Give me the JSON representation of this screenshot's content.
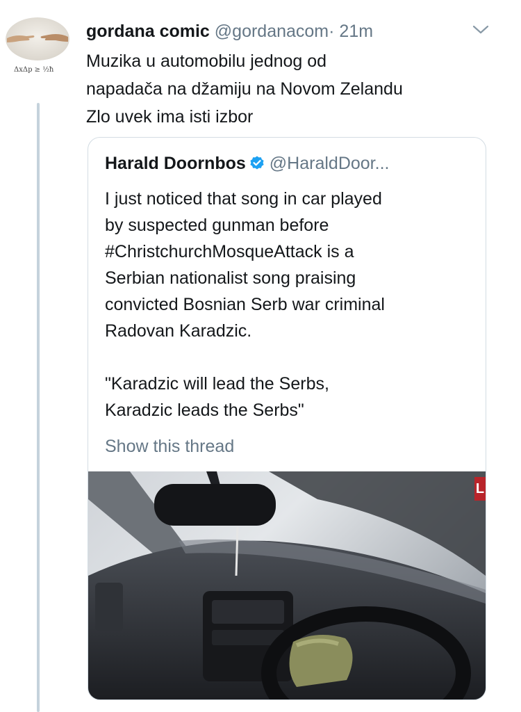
{
  "tweet": {
    "name": "gordana comic",
    "handle": "@gordanacom",
    "separator": "·",
    "time": "21m",
    "lines": [
      "Muzika u automobilu jednog od",
      "napadača na džamiju na Novom Zelandu",
      "Zlo uvek ima isti izbor"
    ],
    "avatar_caption": "ΔxΔp ≥ ½ħ"
  },
  "quoted": {
    "name": "Harald Doornbos",
    "handle": "@HaraldDoor...",
    "lines": [
      "I just noticed that song in car played",
      "by suspected gunman before",
      "#ChristchurchMosqueAttack is a",
      "Serbian nationalist song praising",
      "convicted Bosnian Serb war criminal",
      "Radovan Karadzic."
    ],
    "quote_lines": [
      "\"Karadzic will lead the Serbs,",
      "Karadzic leads the Serbs\""
    ],
    "show_thread": "Show this thread",
    "media_badge": "L"
  },
  "icons": {
    "more": "chevron-down-icon",
    "verified": "verified-badge-icon"
  },
  "colors": {
    "text": "#14171a",
    "secondary": "#657786",
    "verified": "#1da1f2",
    "border": "#d3dce3",
    "thread_line": "#c5d2dc"
  }
}
